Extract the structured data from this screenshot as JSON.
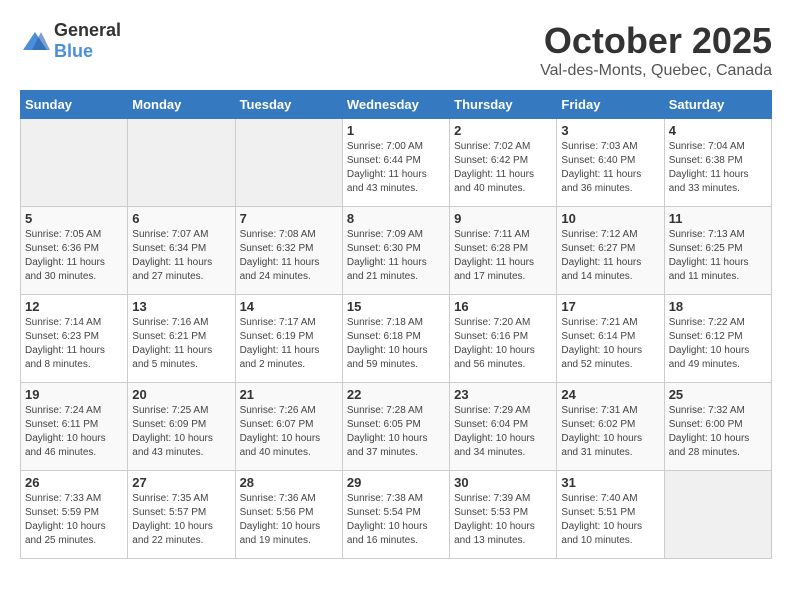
{
  "logo": {
    "text_general": "General",
    "text_blue": "Blue"
  },
  "title": "October 2025",
  "subtitle": "Val-des-Monts, Quebec, Canada",
  "days_of_week": [
    "Sunday",
    "Monday",
    "Tuesday",
    "Wednesday",
    "Thursday",
    "Friday",
    "Saturday"
  ],
  "weeks": [
    [
      {
        "day": "",
        "info": ""
      },
      {
        "day": "",
        "info": ""
      },
      {
        "day": "",
        "info": ""
      },
      {
        "day": "1",
        "info": "Sunrise: 7:00 AM\nSunset: 6:44 PM\nDaylight: 11 hours\nand 43 minutes."
      },
      {
        "day": "2",
        "info": "Sunrise: 7:02 AM\nSunset: 6:42 PM\nDaylight: 11 hours\nand 40 minutes."
      },
      {
        "day": "3",
        "info": "Sunrise: 7:03 AM\nSunset: 6:40 PM\nDaylight: 11 hours\nand 36 minutes."
      },
      {
        "day": "4",
        "info": "Sunrise: 7:04 AM\nSunset: 6:38 PM\nDaylight: 11 hours\nand 33 minutes."
      }
    ],
    [
      {
        "day": "5",
        "info": "Sunrise: 7:05 AM\nSunset: 6:36 PM\nDaylight: 11 hours\nand 30 minutes."
      },
      {
        "day": "6",
        "info": "Sunrise: 7:07 AM\nSunset: 6:34 PM\nDaylight: 11 hours\nand 27 minutes."
      },
      {
        "day": "7",
        "info": "Sunrise: 7:08 AM\nSunset: 6:32 PM\nDaylight: 11 hours\nand 24 minutes."
      },
      {
        "day": "8",
        "info": "Sunrise: 7:09 AM\nSunset: 6:30 PM\nDaylight: 11 hours\nand 21 minutes."
      },
      {
        "day": "9",
        "info": "Sunrise: 7:11 AM\nSunset: 6:28 PM\nDaylight: 11 hours\nand 17 minutes."
      },
      {
        "day": "10",
        "info": "Sunrise: 7:12 AM\nSunset: 6:27 PM\nDaylight: 11 hours\nand 14 minutes."
      },
      {
        "day": "11",
        "info": "Sunrise: 7:13 AM\nSunset: 6:25 PM\nDaylight: 11 hours\nand 11 minutes."
      }
    ],
    [
      {
        "day": "12",
        "info": "Sunrise: 7:14 AM\nSunset: 6:23 PM\nDaylight: 11 hours\nand 8 minutes."
      },
      {
        "day": "13",
        "info": "Sunrise: 7:16 AM\nSunset: 6:21 PM\nDaylight: 11 hours\nand 5 minutes."
      },
      {
        "day": "14",
        "info": "Sunrise: 7:17 AM\nSunset: 6:19 PM\nDaylight: 11 hours\nand 2 minutes."
      },
      {
        "day": "15",
        "info": "Sunrise: 7:18 AM\nSunset: 6:18 PM\nDaylight: 10 hours\nand 59 minutes."
      },
      {
        "day": "16",
        "info": "Sunrise: 7:20 AM\nSunset: 6:16 PM\nDaylight: 10 hours\nand 56 minutes."
      },
      {
        "day": "17",
        "info": "Sunrise: 7:21 AM\nSunset: 6:14 PM\nDaylight: 10 hours\nand 52 minutes."
      },
      {
        "day": "18",
        "info": "Sunrise: 7:22 AM\nSunset: 6:12 PM\nDaylight: 10 hours\nand 49 minutes."
      }
    ],
    [
      {
        "day": "19",
        "info": "Sunrise: 7:24 AM\nSunset: 6:11 PM\nDaylight: 10 hours\nand 46 minutes."
      },
      {
        "day": "20",
        "info": "Sunrise: 7:25 AM\nSunset: 6:09 PM\nDaylight: 10 hours\nand 43 minutes."
      },
      {
        "day": "21",
        "info": "Sunrise: 7:26 AM\nSunset: 6:07 PM\nDaylight: 10 hours\nand 40 minutes."
      },
      {
        "day": "22",
        "info": "Sunrise: 7:28 AM\nSunset: 6:05 PM\nDaylight: 10 hours\nand 37 minutes."
      },
      {
        "day": "23",
        "info": "Sunrise: 7:29 AM\nSunset: 6:04 PM\nDaylight: 10 hours\nand 34 minutes."
      },
      {
        "day": "24",
        "info": "Sunrise: 7:31 AM\nSunset: 6:02 PM\nDaylight: 10 hours\nand 31 minutes."
      },
      {
        "day": "25",
        "info": "Sunrise: 7:32 AM\nSunset: 6:00 PM\nDaylight: 10 hours\nand 28 minutes."
      }
    ],
    [
      {
        "day": "26",
        "info": "Sunrise: 7:33 AM\nSunset: 5:59 PM\nDaylight: 10 hours\nand 25 minutes."
      },
      {
        "day": "27",
        "info": "Sunrise: 7:35 AM\nSunset: 5:57 PM\nDaylight: 10 hours\nand 22 minutes."
      },
      {
        "day": "28",
        "info": "Sunrise: 7:36 AM\nSunset: 5:56 PM\nDaylight: 10 hours\nand 19 minutes."
      },
      {
        "day": "29",
        "info": "Sunrise: 7:38 AM\nSunset: 5:54 PM\nDaylight: 10 hours\nand 16 minutes."
      },
      {
        "day": "30",
        "info": "Sunrise: 7:39 AM\nSunset: 5:53 PM\nDaylight: 10 hours\nand 13 minutes."
      },
      {
        "day": "31",
        "info": "Sunrise: 7:40 AM\nSunset: 5:51 PM\nDaylight: 10 hours\nand 10 minutes."
      },
      {
        "day": "",
        "info": ""
      }
    ]
  ]
}
